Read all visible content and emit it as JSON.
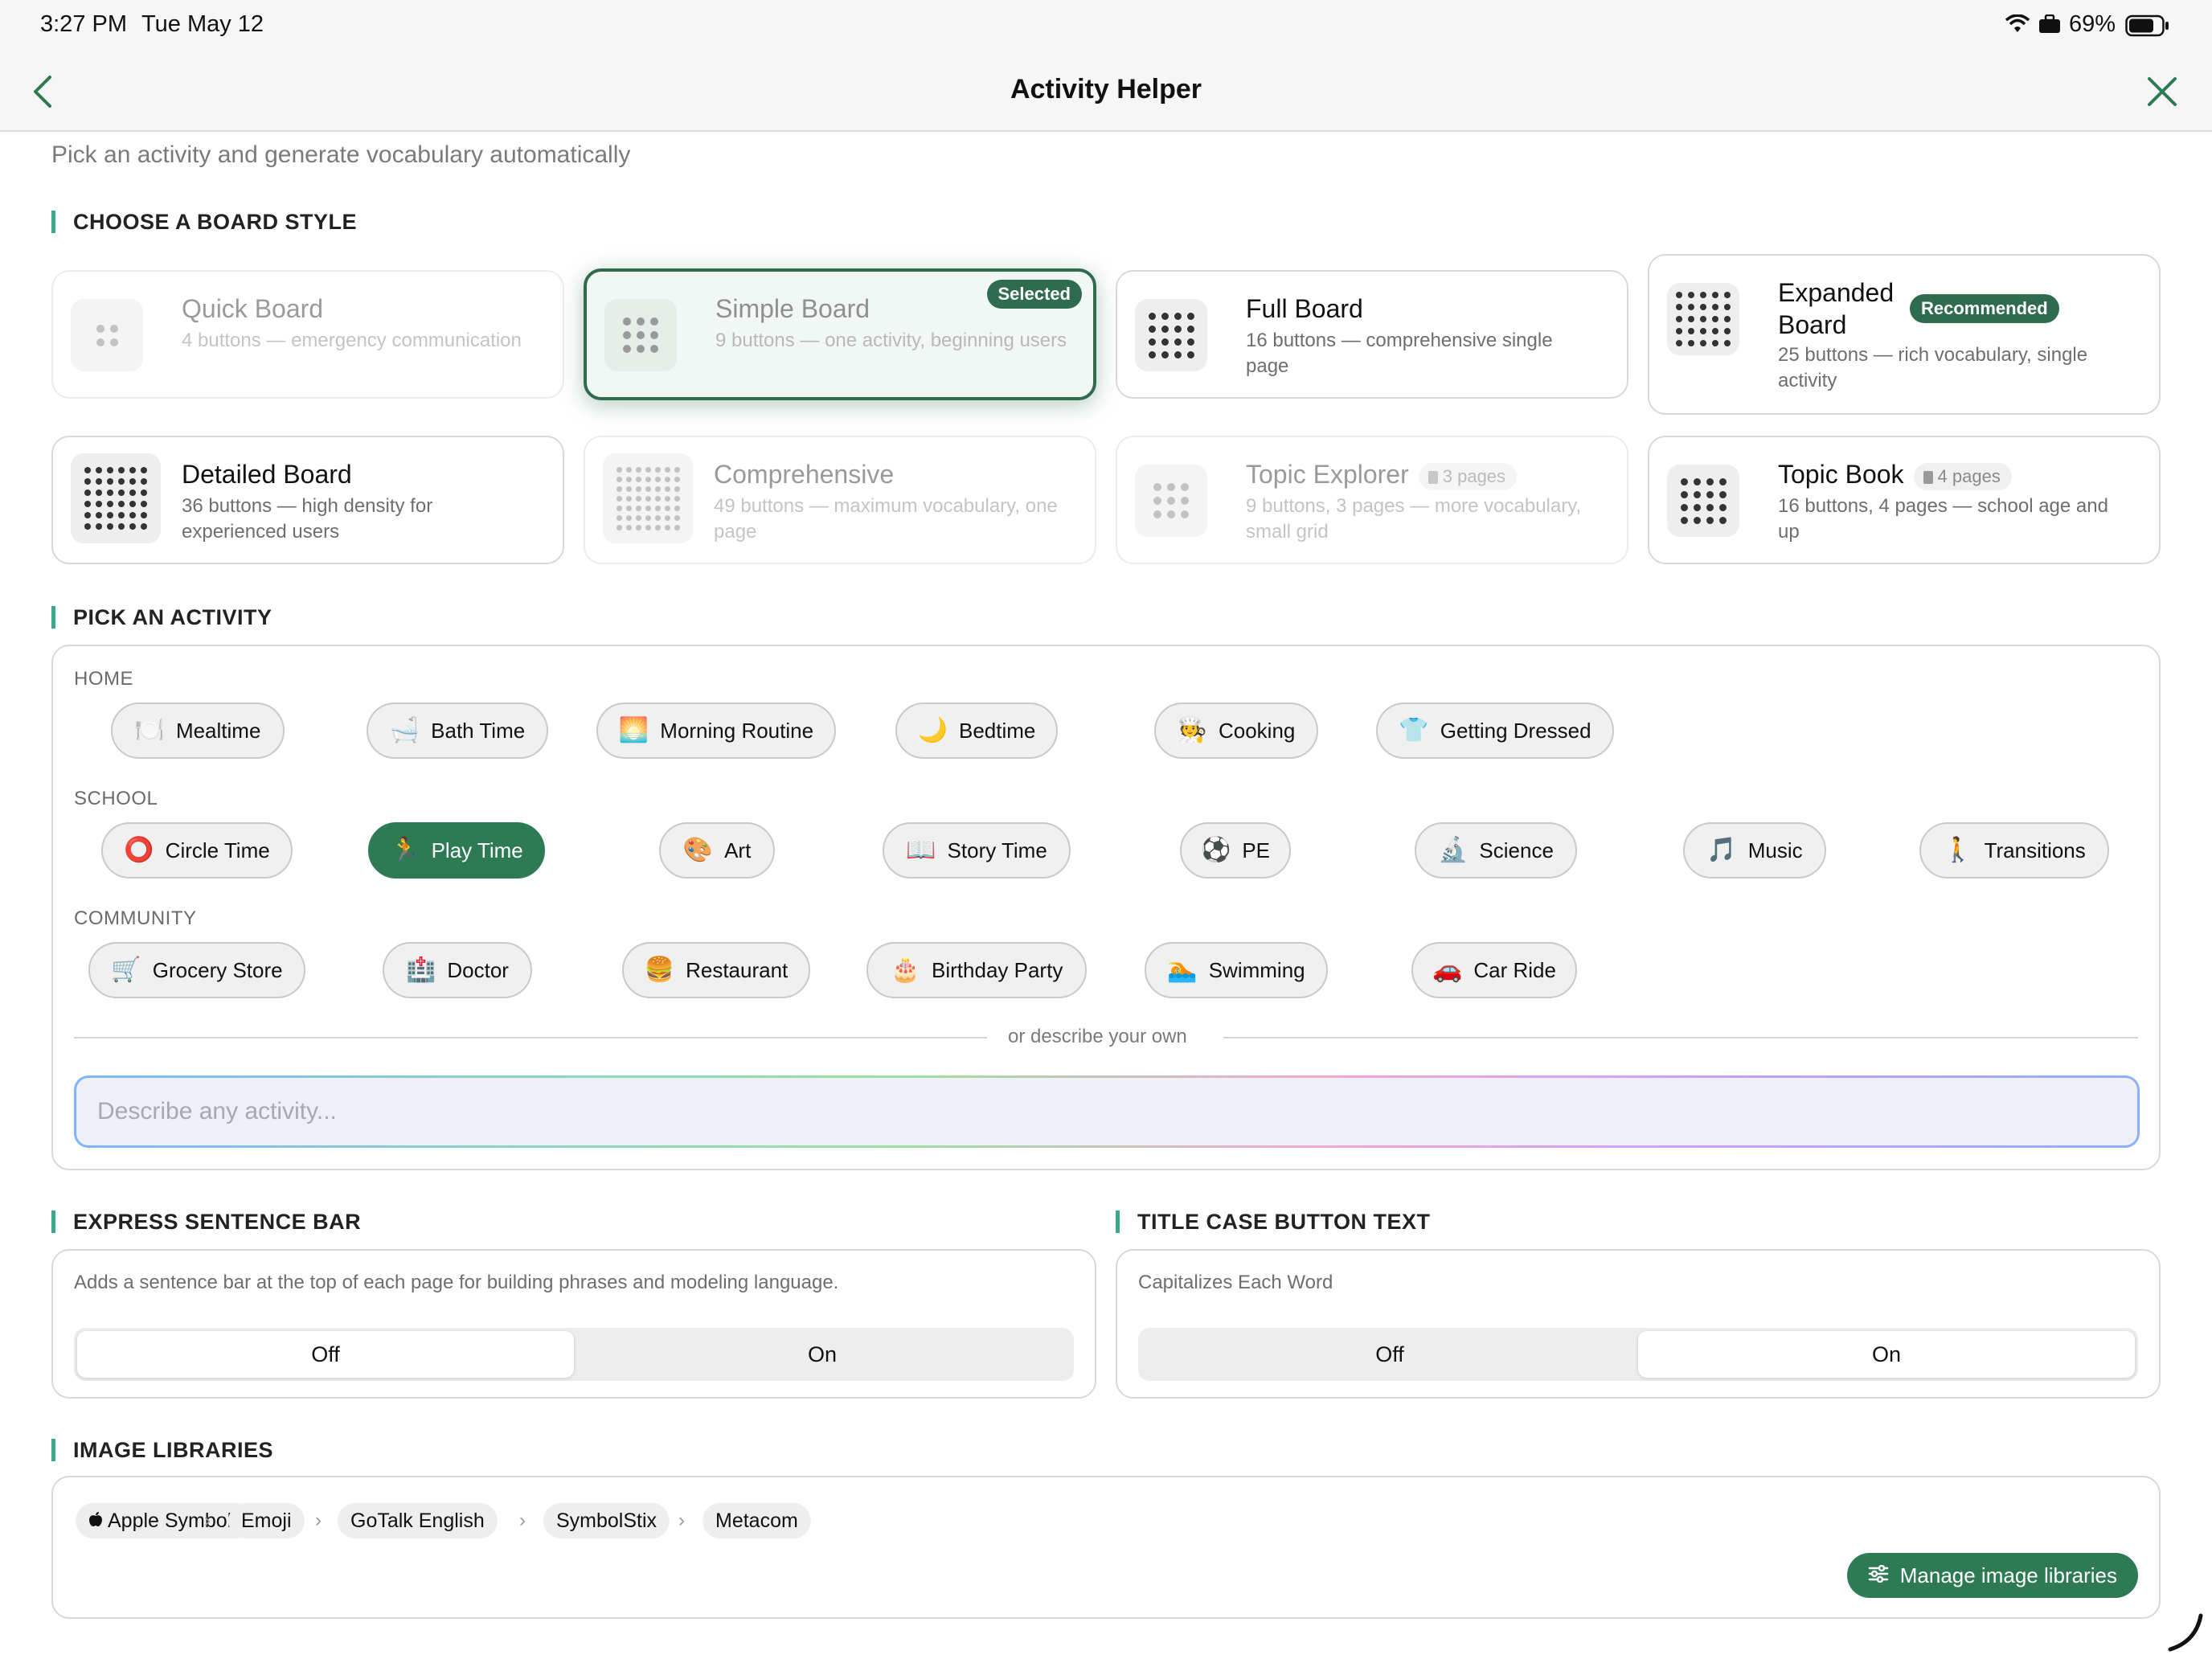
{
  "status_bar": {
    "time": "3:27 PM",
    "date": "Tue May 12",
    "battery": "69%"
  },
  "nav": {
    "title": "Activity Helper"
  },
  "subtitle": "Pick an activity and generate vocabulary automatically",
  "board_section": {
    "title": "CHOOSE A BOARD STYLE",
    "selected_badge": "Selected",
    "recommended_badge": "Recommended",
    "cards": [
      {
        "name": "Quick Board",
        "desc": "4 buttons — emergency communication"
      },
      {
        "name": "Simple Board",
        "desc": "9 buttons — one activity, beginning users"
      },
      {
        "name": "Full Board",
        "desc": "16 buttons — comprehensive single page"
      },
      {
        "name": "Expanded Board",
        "desc": "25 buttons — rich vocabulary, single activity"
      },
      {
        "name": "Detailed Board",
        "desc": "36 buttons — high density for experienced users"
      },
      {
        "name": "Comprehensive",
        "desc": "49 buttons — maximum vocabulary, one page"
      },
      {
        "name": "Topic Explorer",
        "pages": "3 pages",
        "desc": "9 buttons, 3 pages — more vocabulary, small grid"
      },
      {
        "name": "Topic Book",
        "pages": "4 pages",
        "desc": "16 buttons, 4 pages — school age and up"
      }
    ]
  },
  "activity_section": {
    "title": "PICK AN ACTIVITY",
    "categories": [
      {
        "label": "HOME",
        "items": [
          {
            "label": "Mealtime",
            "emoji": "🍽️"
          },
          {
            "label": "Bath Time",
            "emoji": "🛁"
          },
          {
            "label": "Morning Routine",
            "emoji": "🌅"
          },
          {
            "label": "Bedtime",
            "emoji": "🌙"
          },
          {
            "label": "Cooking",
            "emoji": "🧑‍🍳"
          },
          {
            "label": "Getting Dressed",
            "emoji": "👕"
          }
        ]
      },
      {
        "label": "SCHOOL",
        "items": [
          {
            "label": "Circle Time",
            "emoji": "⭕"
          },
          {
            "label": "Play Time",
            "emoji": "🏃"
          },
          {
            "label": "Art",
            "emoji": "🎨"
          },
          {
            "label": "Story Time",
            "emoji": "📖"
          },
          {
            "label": "PE",
            "emoji": "⚽"
          },
          {
            "label": "Science",
            "emoji": "🔬"
          },
          {
            "label": "Music",
            "emoji": "🎵"
          },
          {
            "label": "Transitions",
            "emoji": "🚶"
          }
        ]
      },
      {
        "label": "COMMUNITY",
        "items": [
          {
            "label": "Grocery Store",
            "emoji": "🛒"
          },
          {
            "label": "Doctor",
            "emoji": "🏥"
          },
          {
            "label": "Restaurant",
            "emoji": "🍔"
          },
          {
            "label": "Birthday Party",
            "emoji": "🎂"
          },
          {
            "label": "Swimming",
            "emoji": "🏊"
          },
          {
            "label": "Car Ride",
            "emoji": "🚗"
          }
        ]
      }
    ],
    "or_text": "or describe your own",
    "describe_placeholder": "Describe any activity..."
  },
  "sentence_bar": {
    "title": "EXPRESS SENTENCE BAR",
    "desc": "Adds a sentence bar at the top of each page for building phrases and modeling language.",
    "off": "Off",
    "on": "On",
    "value": "Off"
  },
  "title_case": {
    "title": "TITLE CASE BUTTON TEXT",
    "desc": "Capitalizes Each Word",
    "off": "Off",
    "on": "On",
    "value": "On"
  },
  "libraries": {
    "title": "IMAGE LIBRARIES",
    "items": [
      "Apple Symbols",
      "Emoji",
      "GoTalk English",
      "SymbolStix",
      "Metacom"
    ],
    "manage_label": "Manage image libraries"
  },
  "colors": {
    "accent": "#2e7a55",
    "selected_border": "#2f6b4f",
    "section_bar": "#3aa88a"
  }
}
